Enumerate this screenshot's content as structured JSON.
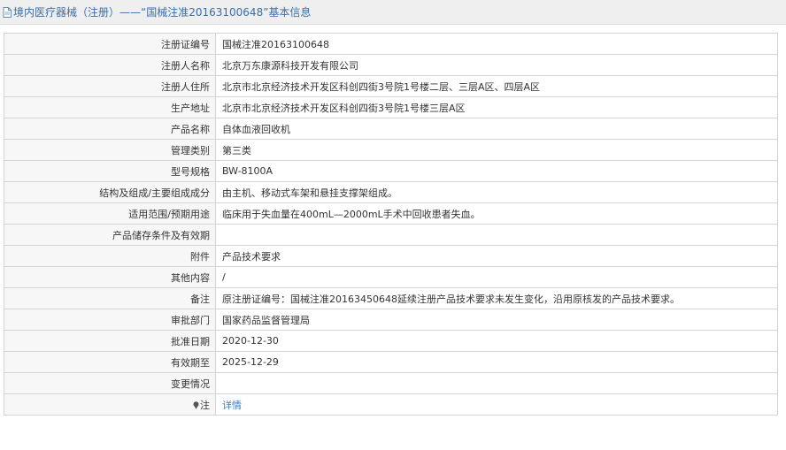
{
  "header": {
    "title": "境内医疗器械（注册）——“国械注准20163100648”基本信息"
  },
  "rows": [
    {
      "label": "注册证编号",
      "value": "国械注准20163100648"
    },
    {
      "label": "注册人名称",
      "value": "北京万东康源科技开发有限公司"
    },
    {
      "label": "注册人住所",
      "value": "北京市北京经济技术开发区科创四街3号院1号楼二层、三层A区、四层A区"
    },
    {
      "label": "生产地址",
      "value": "北京市北京经济技术开发区科创四街3号院1号楼三层A区"
    },
    {
      "label": "产品名称",
      "value": "自体血液回收机"
    },
    {
      "label": "管理类别",
      "value": "第三类"
    },
    {
      "label": "型号规格",
      "value": "BW-8100A"
    },
    {
      "label": "结构及组成/主要组成成分",
      "value": "由主机、移动式车架和悬挂支撑架组成。"
    },
    {
      "label": "适用范围/预期用途",
      "value": "临床用于失血量在400mL—2000mL手术中回收患者失血。"
    },
    {
      "label": "产品储存条件及有效期",
      "value": ""
    },
    {
      "label": "附件",
      "value": "产品技术要求"
    },
    {
      "label": "其他内容",
      "value": "/"
    },
    {
      "label": "备注",
      "value": "原注册证编号：国械注准20163450648延续注册产品技术要求未发生变化，沿用原核发的产品技术要求。"
    },
    {
      "label": "审批部门",
      "value": "国家药品监督管理局"
    },
    {
      "label": "批准日期",
      "value": "2020-12-30"
    },
    {
      "label": "有效期至",
      "value": "2025-12-29"
    },
    {
      "label": "变更情况",
      "value": ""
    }
  ],
  "note_row": {
    "label": "注",
    "link": "详情",
    "icon": "map-pin-icon"
  },
  "colors": {
    "title": "#3a6ea5",
    "link": "#3b7dc2",
    "label_bg": "#f7f7f7",
    "border": "#d4d4d4",
    "header_bg": "#efefef"
  }
}
